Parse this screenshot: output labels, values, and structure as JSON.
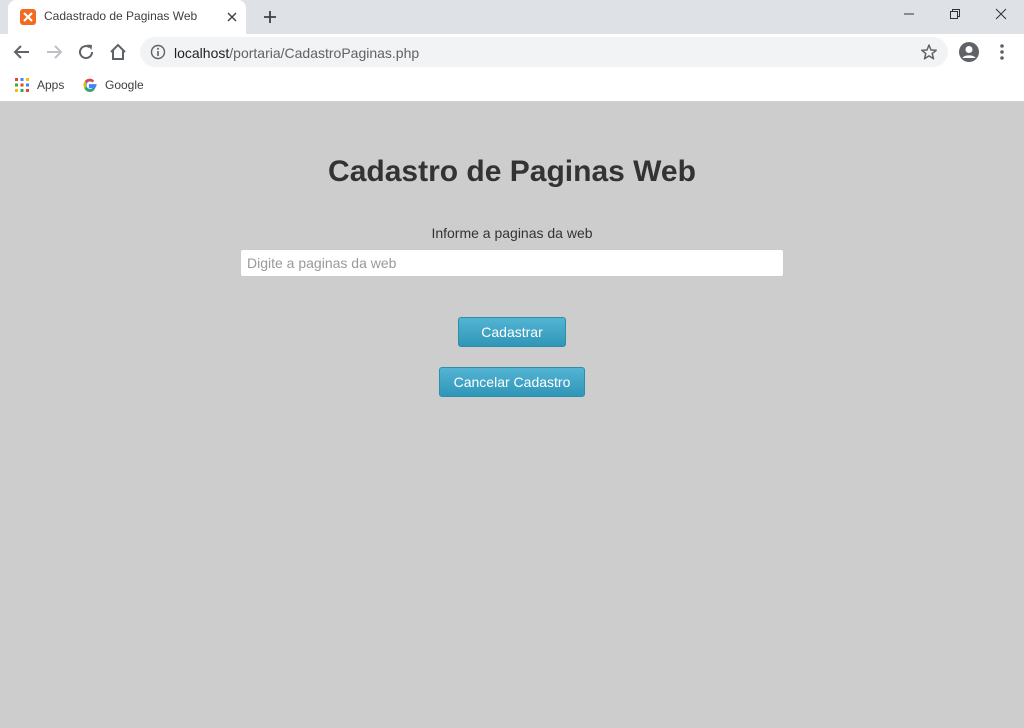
{
  "browser": {
    "tab_title": "Cadastrado de Paginas Web",
    "url_host": "localhost",
    "url_path": "/portaria/CadastroPaginas.php",
    "bookmarks": [
      {
        "label": "Apps",
        "icon": "apps-grid-icon"
      },
      {
        "label": "Google",
        "icon": "google-g-icon"
      }
    ]
  },
  "page": {
    "title": "Cadastro de Paginas Web",
    "field_label": "Informe a paginas da web",
    "input_placeholder": "Digite a paginas da web",
    "input_value": "",
    "submit_label": "Cadastrar",
    "cancel_label": "Cancelar Cadastro"
  },
  "colors": {
    "page_background": "#cdcdcd",
    "button_top": "#54b4d3",
    "button_bottom": "#2f96b8",
    "favicon": "#f26b21"
  }
}
